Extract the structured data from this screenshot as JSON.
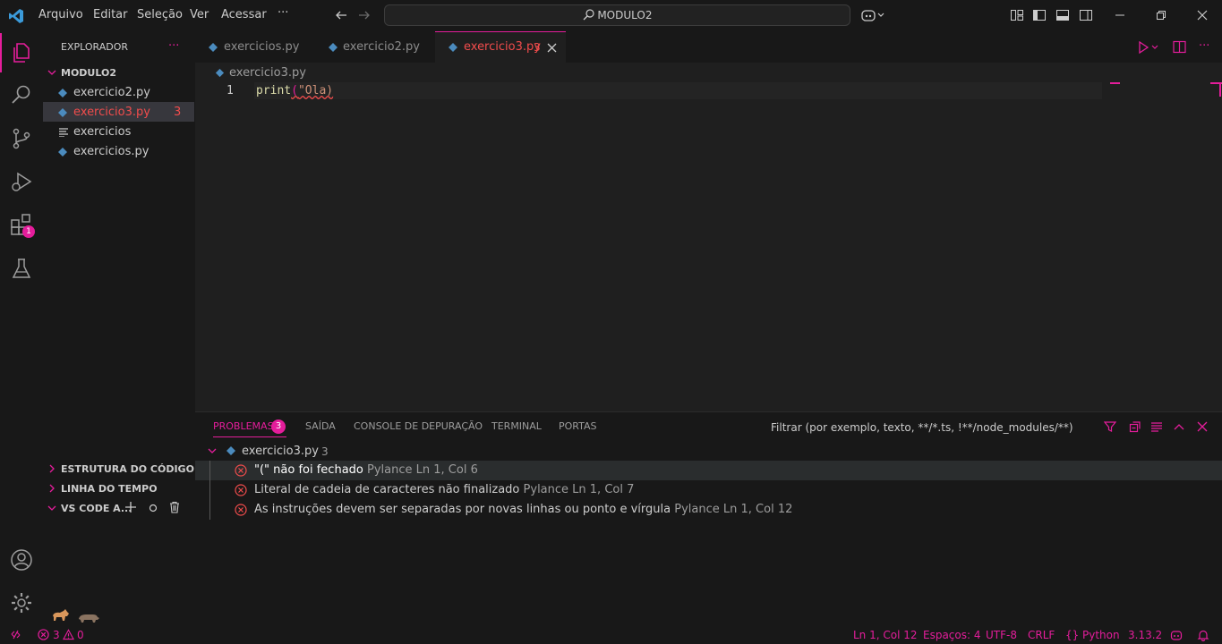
{
  "titlebar": {
    "menu": [
      "Arquivo",
      "Editar",
      "Seleção",
      "Ver",
      "Acessar",
      "···"
    ],
    "search": "MODULO2"
  },
  "activity": {
    "extensions_badge": "1"
  },
  "sidebar": {
    "header": "EXPLORADOR",
    "more": "···",
    "folder": "MODULO2",
    "files": [
      {
        "name": "exercicio2.py",
        "badge": ""
      },
      {
        "name": "exercicio3.py",
        "badge": "3"
      },
      {
        "name": "exercicios",
        "badge": ""
      },
      {
        "name": "exercicios.py",
        "badge": ""
      }
    ],
    "sections": [
      "ESTRUTURA DO CÓDIGO",
      "LINHA DO TEMPO",
      "VS CODE A..."
    ]
  },
  "tabs": [
    {
      "label": "exercicios.py"
    },
    {
      "label": "exercicio2.py"
    },
    {
      "label": "exercicio3.py",
      "badge": "3"
    }
  ],
  "editor": {
    "breadcrumb": "exercicio3.py",
    "line_number": "1",
    "code_fn": "print",
    "code_paren": "(",
    "code_str": "\"Ola)"
  },
  "panel": {
    "tabs": [
      "PROBLEMAS",
      "SAÍDA",
      "CONSOLE DE DEPURAÇÃO",
      "TERMINAL",
      "PORTAS"
    ],
    "problems_count": "3",
    "filter_placeholder": "Filtrar (por exemplo, texto, **/*.ts, !**/node_modules/**)",
    "file": "exercicio3.py",
    "file_count": "3",
    "problems": [
      {
        "message": "\"(\" não foi fechado",
        "source": "Pylance",
        "location": "Ln 1, Col 6"
      },
      {
        "message": "Literal de cadeia de caracteres não finalizado",
        "source": "Pylance",
        "location": "Ln 1, Col 7"
      },
      {
        "message": "As instruções devem ser separadas por novas linhas ou ponto e vírgula",
        "source": "Pylance",
        "location": "Ln 1, Col 12"
      }
    ]
  },
  "statusbar": {
    "errors": "3",
    "warnings": "0",
    "position": "Ln 1, Col 12",
    "spaces": "Espaços: 4",
    "encoding": "UTF-8",
    "eol": "CRLF",
    "language": "Python",
    "version": "3.13.2"
  },
  "colors": {
    "accent": "#e41d9b",
    "error": "#f14c4c",
    "python": "#4b8bbe"
  }
}
